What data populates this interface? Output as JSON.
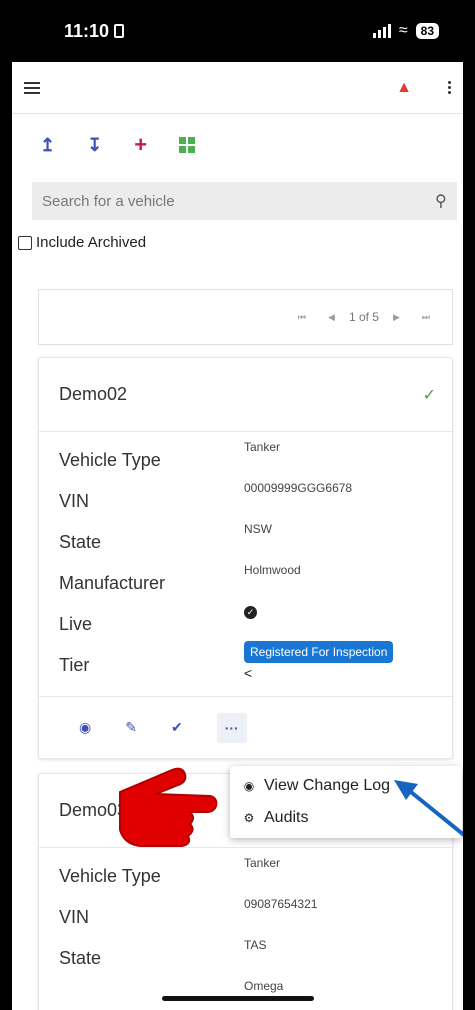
{
  "status": {
    "time": "11:10",
    "battery": "83"
  },
  "search": {
    "placeholder": "Search for a vehicle"
  },
  "archived_label": "Include Archived",
  "pagination": {
    "text": "1 of 5"
  },
  "vehicles": [
    {
      "name": "Demo02",
      "labels": [
        "Vehicle Type",
        "VIN",
        "State",
        "Manufacturer",
        "Live",
        "Tier"
      ],
      "vehicle_type": "Tanker",
      "vin": "00009999GGG6678",
      "state": "NSW",
      "manufacturer": "Holmwood",
      "tier": "Registered For Inspection"
    },
    {
      "name": "Demo03",
      "labels": [
        "Vehicle Type",
        "VIN",
        "State"
      ],
      "vehicle_type": "Tanker",
      "vin": "09087654321",
      "state": "TAS",
      "manufacturer": "Omega"
    }
  ],
  "menu": {
    "items": [
      "View Change Log",
      "Audits"
    ]
  },
  "colors": {
    "primary": "#3f51b5",
    "tier_pill": "#1976d2",
    "bell": "#e53935",
    "check": "#43a047"
  }
}
